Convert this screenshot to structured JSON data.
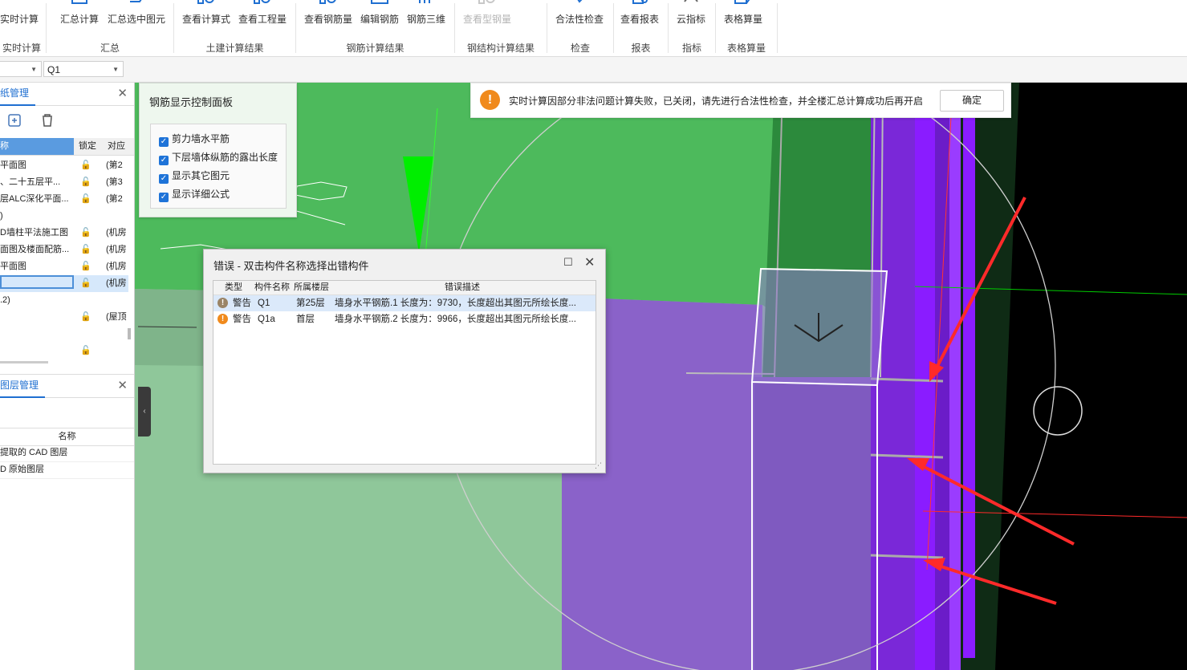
{
  "ribbon": {
    "buttons": [
      {
        "label": "实时计算"
      },
      {
        "label": "汇总计算"
      },
      {
        "label": "汇总选中图元"
      },
      {
        "label": "查看计算式"
      },
      {
        "label": "查看工程量"
      },
      {
        "label": "查看钢筋量"
      },
      {
        "label": "编辑钢筋"
      },
      {
        "label": "钢筋三维"
      },
      {
        "label": "查看型钢量"
      },
      {
        "label": "合法性检查"
      },
      {
        "label": "查看报表"
      },
      {
        "label": "云指标"
      },
      {
        "label": "表格算量"
      }
    ],
    "groups": [
      "实时计算",
      "汇总",
      "土建计算结果",
      "钢筋计算结果",
      "钢结构计算结果",
      "检查",
      "报表",
      "指标",
      "表格算量"
    ]
  },
  "toolbar": {
    "combo1": "",
    "combo2": "Q1"
  },
  "drawing_panel": {
    "title": "纸管理",
    "columns": [
      "称",
      "锁定",
      "对应"
    ],
    "rows": [
      {
        "name": "平面图",
        "lock": "(第2"
      },
      {
        "name": "、二十五层平...",
        "lock": "(第3"
      },
      {
        "name": "层ALC深化平面...",
        "lock": "(第2"
      },
      {
        "name": ")",
        "lock": ""
      },
      {
        "name": "D墙柱平法施工图",
        "lock": "(机房"
      },
      {
        "name": "面图及楼面配筋...",
        "lock": "(机房"
      },
      {
        "name": "平面图",
        "lock": "(机房"
      },
      {
        "name": "",
        "lock": "(机房"
      },
      {
        "name": ".2)",
        "lock": ""
      },
      {
        "name": "",
        "lock": "(屋顶"
      },
      {
        "name": "",
        "lock": ""
      },
      {
        "name": "",
        "lock": ""
      }
    ]
  },
  "layer_panel": {
    "title": "图层管理",
    "column": "名称",
    "rows": [
      "提取的 CAD 图层",
      "D 原始图层"
    ]
  },
  "rebar_panel": {
    "title": "钢筋显示控制面板",
    "options": [
      "剪力墙水平筋",
      "下层墙体纵筋的露出长度",
      "显示其它图元",
      "显示详细公式"
    ]
  },
  "notice": {
    "message": "实时计算因部分非法问题计算失败，已关闭，请先进行合法性检查，并全楼汇总计算成功后再开启",
    "ok": "确定"
  },
  "error_dialog": {
    "title": "错误 - 双击构件名称选择出错构件",
    "columns": [
      "类型",
      "构件名称",
      "所属楼层",
      "错误描述"
    ],
    "rows": [
      {
        "type": "警告",
        "name": "Q1",
        "floor": "第25层",
        "desc": "墙身水平钢筋.1 长度为：9730，长度超出其图元所绘长度..."
      },
      {
        "type": "警告",
        "name": "Q1a",
        "floor": "首层",
        "desc": "墙身水平钢筋.2 长度为：9966，长度超出其图元所绘长度..."
      }
    ]
  },
  "colors": {
    "accent": "#1f6fd1",
    "warning": "#f08a1c",
    "canvas_green": "#4dba5c",
    "canvas_purple": "#8a62c9",
    "rebar_violet": "#8a1cff",
    "background_black": "#000000",
    "annotation_red": "#ff2a2a"
  }
}
